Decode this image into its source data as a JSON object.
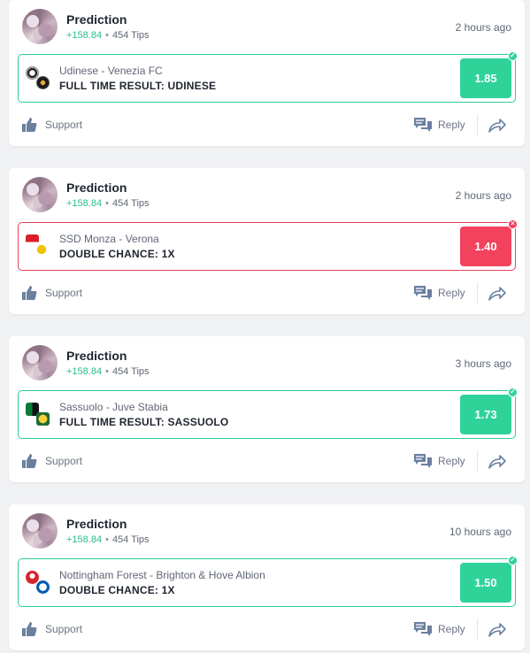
{
  "cards": [
    {
      "tipster": {
        "name": "Prediction",
        "profit": "+158.84",
        "tips": "454 Tips"
      },
      "time_ago": "2 hours ago",
      "match": "Udinese - Venezia FC",
      "market": "FULL TIME RESULT: UDINESE",
      "odds": "1.85",
      "status": "won",
      "status_mark": "✓",
      "logos": [
        "udinese-crest-icon",
        "venezia-crest-icon"
      ]
    },
    {
      "tipster": {
        "name": "Prediction",
        "profit": "+158.84",
        "tips": "454 Tips"
      },
      "time_ago": "2 hours ago",
      "match": "SSD Monza - Verona",
      "market": "DOUBLE CHANCE: 1X",
      "odds": "1.40",
      "status": "lost",
      "status_mark": "×",
      "logos": [
        "monza-crest-icon",
        "verona-crest-icon"
      ]
    },
    {
      "tipster": {
        "name": "Prediction",
        "profit": "+158.84",
        "tips": "454 Tips"
      },
      "time_ago": "3 hours ago",
      "match": "Sassuolo - Juve Stabia",
      "market": "FULL TIME RESULT: SASSUOLO",
      "odds": "1.73",
      "status": "won",
      "status_mark": "✓",
      "logos": [
        "sassuolo-crest-icon",
        "juve-stabia-crest-icon"
      ]
    },
    {
      "tipster": {
        "name": "Prediction",
        "profit": "+158.84",
        "tips": "454 Tips"
      },
      "time_ago": "10 hours ago",
      "match": "Nottingham Forest - Brighton & Hove Albion",
      "market": "DOUBLE CHANCE: 1X",
      "odds": "1.50",
      "status": "won",
      "status_mark": "✓",
      "logos": [
        "nottingham-forest-crest-icon",
        "brighton-crest-icon"
      ]
    }
  ],
  "actions": {
    "support_label": "Support",
    "reply_label": "Reply"
  },
  "colors": {
    "win": "#2fd39a",
    "loss": "#f2425d",
    "profit": "#27c089",
    "icon": "#6b7fa0"
  }
}
